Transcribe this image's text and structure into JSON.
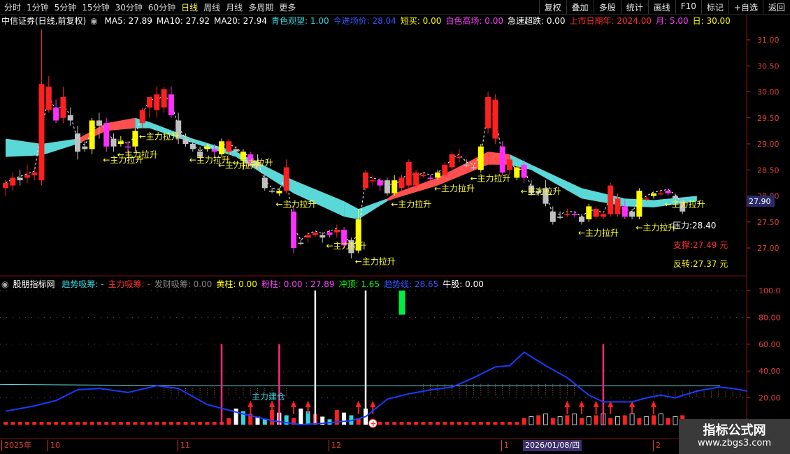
{
  "toolbar": {
    "timeframes": [
      "分时",
      "1分钟",
      "5分钟",
      "15分钟",
      "30分钟",
      "60分钟",
      "日线",
      "周线",
      "月线",
      "多周期",
      "更多"
    ],
    "active_timeframe": "日线",
    "buttons": [
      "复权",
      "叠加",
      "多股",
      "统计",
      "画线",
      "F10",
      "标记",
      "+自选",
      "返回"
    ]
  },
  "main_legend": {
    "title": "中信证券(日线,前复权)",
    "items": [
      {
        "label": "MA5: 27.89",
        "color": "#ffffff"
      },
      {
        "label": "MA10: 27.92",
        "color": "#ffffff"
      },
      {
        "label": "MA20: 27.94",
        "color": "#ffffff"
      },
      {
        "label": "青色观望: 1.00",
        "color": "#33d6e0"
      },
      {
        "label": "今进场价: 28.04",
        "color": "#3355ff"
      },
      {
        "label": "短买: 0.00",
        "color": "#ffff00"
      },
      {
        "label": "白色高场: 0.00",
        "color": "#ff40ff"
      },
      {
        "label": "急速超跌: 0.00",
        "color": "#ffffff"
      },
      {
        "label": "上市日期年: 2024.00",
        "color": "#ff3030"
      },
      {
        "label": "月: 5.00",
        "color": "#ff40ff"
      },
      {
        "label": "日: 30.00",
        "color": "#ffff00"
      }
    ]
  },
  "sub_legend": {
    "title": "股朋指标网",
    "items": [
      {
        "label": "趋势吸筹: -",
        "color": "#33d6e0"
      },
      {
        "label": "主力吸筹: -",
        "color": "#ff3030"
      },
      {
        "label": "发财吸筹: 0.00",
        "color": "#888888"
      },
      {
        "label": "黄柱: 0.00",
        "color": "#ffff00"
      },
      {
        "label": "粉柱: 0.00 : 27.89",
        "color": "#ff40ff"
      },
      {
        "label": "冲顶: 1.65",
        "color": "#00ff00"
      },
      {
        "label": "趋势线: 28.65",
        "color": "#3355ff"
      },
      {
        "label": "牛股: 0.00",
        "color": "#ffffff"
      }
    ]
  },
  "price_axis": {
    "ticks": [
      "31.00",
      "30.50",
      "30.00",
      "29.50",
      "29.00",
      "28.50",
      "28.00",
      "27.50",
      "27.00"
    ],
    "current": "27.90"
  },
  "sub_axis": {
    "ticks": [
      "100.0",
      "80.00",
      "60.00",
      "40.00",
      "20.00"
    ]
  },
  "annotations": {
    "signal_label": "←主力拉升",
    "build_label": "主力建仓",
    "support": "支撑:27.49 元",
    "reversal": "反转:27.37 元",
    "resistance_partial": "压力:28.40"
  },
  "date_axis": {
    "labels": [
      "2025年",
      "10",
      "11",
      "12",
      "1",
      "2"
    ],
    "cursor_date": "2026/01/08/四"
  },
  "watermark": {
    "line1": "指标公式网",
    "line2": "www.zbgs3.com"
  },
  "colors": {
    "up": "#ff2020",
    "down": "#c0c0c0",
    "yellow": "#ffff00",
    "magenta": "#ff30ff",
    "band_cyan": "#5ad8d8",
    "band_red": "#ff5050"
  },
  "chart_data": {
    "type": "candlestick",
    "ylim": [
      26.8,
      31.4
    ],
    "candles": [
      {
        "o": 28.15,
        "h": 28.3,
        "l": 28.0,
        "c": 28.25,
        "k": "up"
      },
      {
        "o": 28.2,
        "h": 28.45,
        "l": 28.1,
        "c": 28.35,
        "k": "up"
      },
      {
        "o": 28.3,
        "h": 28.5,
        "l": 28.2,
        "c": 28.35,
        "k": "down"
      },
      {
        "o": 28.35,
        "h": 28.6,
        "l": 28.25,
        "c": 28.4,
        "k": "up"
      },
      {
        "o": 28.4,
        "h": 28.55,
        "l": 28.3,
        "c": 28.45,
        "k": "up"
      },
      {
        "o": 28.3,
        "h": 31.2,
        "l": 28.2,
        "c": 30.15,
        "k": "up"
      },
      {
        "o": 30.1,
        "h": 30.3,
        "l": 29.6,
        "c": 29.65,
        "k": "up"
      },
      {
        "o": 29.7,
        "h": 29.85,
        "l": 29.4,
        "c": 29.45,
        "k": "mag"
      },
      {
        "o": 29.5,
        "h": 30.1,
        "l": 29.4,
        "c": 29.9,
        "k": "up"
      },
      {
        "o": 29.55,
        "h": 29.7,
        "l": 29.35,
        "c": 29.45,
        "k": "down"
      },
      {
        "o": 29.2,
        "h": 29.35,
        "l": 28.7,
        "c": 28.85,
        "k": "down"
      },
      {
        "o": 28.9,
        "h": 29.05,
        "l": 28.85,
        "c": 28.95,
        "k": "down"
      },
      {
        "o": 28.9,
        "h": 29.5,
        "l": 28.8,
        "c": 29.45,
        "k": "yel"
      },
      {
        "o": 29.45,
        "h": 29.6,
        "l": 29.1,
        "c": 29.35,
        "k": "down"
      },
      {
        "o": 29.4,
        "h": 29.5,
        "l": 28.85,
        "c": 28.95,
        "k": "mag"
      },
      {
        "o": 28.95,
        "h": 29.2,
        "l": 28.85,
        "c": 29.1,
        "k": "down"
      },
      {
        "o": 29.05,
        "h": 29.15,
        "l": 28.95,
        "c": 29.0,
        "k": "yel"
      },
      {
        "o": 28.95,
        "h": 29.05,
        "l": 28.8,
        "c": 28.95,
        "k": "mag"
      },
      {
        "o": 28.95,
        "h": 29.3,
        "l": 28.85,
        "c": 29.25,
        "k": "yel"
      },
      {
        "o": 29.4,
        "h": 29.7,
        "l": 29.3,
        "c": 29.65,
        "k": "up"
      },
      {
        "o": 29.7,
        "h": 29.9,
        "l": 29.5,
        "c": 29.9,
        "k": "up"
      },
      {
        "o": 29.65,
        "h": 30.1,
        "l": 29.5,
        "c": 29.95,
        "k": "up"
      },
      {
        "o": 29.7,
        "h": 30.1,
        "l": 29.6,
        "c": 30.05,
        "k": "up"
      },
      {
        "o": 29.95,
        "h": 30.1,
        "l": 29.5,
        "c": 29.55,
        "k": "mag"
      },
      {
        "o": 29.45,
        "h": 29.6,
        "l": 29.0,
        "c": 29.1,
        "k": "down"
      },
      {
        "o": 29.1,
        "h": 29.2,
        "l": 28.95,
        "c": 29.0,
        "k": "down"
      },
      {
        "o": 29.0,
        "h": 29.1,
        "l": 28.85,
        "c": 28.9,
        "k": "down"
      },
      {
        "o": 28.85,
        "h": 28.95,
        "l": 28.7,
        "c": 28.75,
        "k": "down"
      },
      {
        "o": 28.9,
        "h": 29.0,
        "l": 28.85,
        "c": 28.95,
        "k": "yel"
      },
      {
        "o": 28.9,
        "h": 29.0,
        "l": 28.75,
        "c": 28.85,
        "k": "mag"
      },
      {
        "o": 28.8,
        "h": 29.1,
        "l": 28.75,
        "c": 29.05,
        "k": "yel"
      },
      {
        "o": 28.85,
        "h": 29.1,
        "l": 28.7,
        "c": 29.05,
        "k": "up"
      },
      {
        "o": 28.85,
        "h": 28.95,
        "l": 28.8,
        "c": 28.9,
        "k": "down"
      },
      {
        "o": 28.7,
        "h": 28.9,
        "l": 28.5,
        "c": 28.85,
        "k": "yel"
      },
      {
        "o": 28.8,
        "h": 28.85,
        "l": 28.55,
        "c": 28.6,
        "k": "mag"
      },
      {
        "o": 28.65,
        "h": 28.8,
        "l": 28.5,
        "c": 28.55,
        "k": "down"
      },
      {
        "o": 28.35,
        "h": 28.45,
        "l": 28.1,
        "c": 28.15,
        "k": "down"
      },
      {
        "o": 28.1,
        "h": 28.15,
        "l": 28.05,
        "c": 28.1,
        "k": "down"
      },
      {
        "o": 28.05,
        "h": 28.15,
        "l": 28.0,
        "c": 28.1,
        "k": "yel"
      },
      {
        "o": 28.1,
        "h": 28.7,
        "l": 28.05,
        "c": 28.55,
        "k": "up"
      },
      {
        "o": 27.7,
        "h": 27.8,
        "l": 26.9,
        "c": 27.0,
        "k": "mag"
      },
      {
        "o": 27.1,
        "h": 27.15,
        "l": 27.05,
        "c": 27.1,
        "k": "down"
      },
      {
        "o": 27.2,
        "h": 27.3,
        "l": 27.1,
        "c": 27.25,
        "k": "up"
      },
      {
        "o": 27.25,
        "h": 27.3,
        "l": 27.2,
        "c": 27.3,
        "k": "up"
      },
      {
        "o": 27.2,
        "h": 27.3,
        "l": 27.1,
        "c": 27.25,
        "k": "down"
      },
      {
        "o": 27.25,
        "h": 27.35,
        "l": 27.2,
        "c": 27.3,
        "k": "mag"
      },
      {
        "o": 27.3,
        "h": 27.45,
        "l": 27.2,
        "c": 27.35,
        "k": "up"
      },
      {
        "o": 27.35,
        "h": 27.4,
        "l": 27.0,
        "c": 27.05,
        "k": "mag"
      },
      {
        "o": 27.15,
        "h": 27.2,
        "l": 26.8,
        "c": 26.9,
        "k": "down"
      },
      {
        "o": 26.95,
        "h": 27.75,
        "l": 26.9,
        "c": 27.55,
        "k": "yel"
      },
      {
        "o": 28.15,
        "h": 28.5,
        "l": 28.1,
        "c": 28.45,
        "k": "up"
      },
      {
        "o": 28.3,
        "h": 28.4,
        "l": 28.2,
        "c": 28.3,
        "k": "up"
      },
      {
        "o": 28.2,
        "h": 28.35,
        "l": 28.1,
        "c": 28.3,
        "k": "mag"
      },
      {
        "o": 28.3,
        "h": 28.35,
        "l": 28.0,
        "c": 28.05,
        "k": "down"
      },
      {
        "o": 28.05,
        "h": 28.4,
        "l": 28.0,
        "c": 28.3,
        "k": "yel"
      },
      {
        "o": 28.15,
        "h": 28.4,
        "l": 28.1,
        "c": 28.35,
        "k": "up"
      },
      {
        "o": 28.2,
        "h": 28.7,
        "l": 28.15,
        "c": 28.65,
        "k": "up"
      },
      {
        "o": 28.2,
        "h": 28.5,
        "l": 28.15,
        "c": 28.45,
        "k": "up"
      },
      {
        "o": 28.4,
        "h": 28.45,
        "l": 28.35,
        "c": 28.4,
        "k": "up"
      },
      {
        "o": 28.35,
        "h": 28.4,
        "l": 28.3,
        "c": 28.35,
        "k": "mag"
      },
      {
        "o": 28.35,
        "h": 28.5,
        "l": 28.3,
        "c": 28.45,
        "k": "yel"
      },
      {
        "o": 28.4,
        "h": 28.65,
        "l": 28.35,
        "c": 28.6,
        "k": "up"
      },
      {
        "o": 28.55,
        "h": 28.85,
        "l": 28.5,
        "c": 28.8,
        "k": "up"
      },
      {
        "o": 28.75,
        "h": 28.9,
        "l": 28.65,
        "c": 28.75,
        "k": "up"
      },
      {
        "o": 28.6,
        "h": 28.7,
        "l": 28.55,
        "c": 28.6,
        "k": "down"
      },
      {
        "o": 28.55,
        "h": 28.6,
        "l": 28.5,
        "c": 28.55,
        "k": "down"
      },
      {
        "o": 28.5,
        "h": 29.0,
        "l": 28.45,
        "c": 28.95,
        "k": "yel"
      },
      {
        "o": 29.3,
        "h": 30.0,
        "l": 29.2,
        "c": 29.9,
        "k": "up"
      },
      {
        "o": 29.1,
        "h": 29.95,
        "l": 29.0,
        "c": 29.85,
        "k": "up"
      },
      {
        "o": 28.95,
        "h": 29.05,
        "l": 28.4,
        "c": 28.45,
        "k": "mag"
      },
      {
        "o": 28.5,
        "h": 28.8,
        "l": 28.4,
        "c": 28.7,
        "k": "up"
      },
      {
        "o": 28.35,
        "h": 28.6,
        "l": 28.3,
        "c": 28.55,
        "k": "yel"
      },
      {
        "o": 28.6,
        "h": 28.7,
        "l": 28.25,
        "c": 28.35,
        "k": "mag"
      },
      {
        "o": 28.2,
        "h": 28.3,
        "l": 28.0,
        "c": 28.05,
        "k": "down"
      },
      {
        "o": 28.05,
        "h": 28.15,
        "l": 28.0,
        "c": 28.1,
        "k": "down"
      },
      {
        "o": 28.15,
        "h": 28.3,
        "l": 27.8,
        "c": 27.85,
        "k": "down"
      },
      {
        "o": 27.7,
        "h": 27.8,
        "l": 27.45,
        "c": 27.5,
        "k": "down"
      },
      {
        "o": 27.6,
        "h": 27.7,
        "l": 27.55,
        "c": 27.6,
        "k": "down"
      },
      {
        "o": 27.65,
        "h": 27.75,
        "l": 27.6,
        "c": 27.65,
        "k": "up"
      },
      {
        "o": 27.65,
        "h": 27.7,
        "l": 27.6,
        "c": 27.65,
        "k": "mag"
      },
      {
        "o": 27.5,
        "h": 27.65,
        "l": 27.45,
        "c": 27.6,
        "k": "down"
      },
      {
        "o": 27.55,
        "h": 27.85,
        "l": 27.5,
        "c": 27.8,
        "k": "yel"
      },
      {
        "o": 27.6,
        "h": 27.8,
        "l": 27.55,
        "c": 27.75,
        "k": "up"
      },
      {
        "o": 27.6,
        "h": 27.7,
        "l": 27.55,
        "c": 27.65,
        "k": "up"
      },
      {
        "o": 27.65,
        "h": 28.25,
        "l": 27.6,
        "c": 28.2,
        "k": "up"
      },
      {
        "o": 27.65,
        "h": 28.05,
        "l": 27.6,
        "c": 27.95,
        "k": "up"
      },
      {
        "o": 27.8,
        "h": 27.9,
        "l": 27.55,
        "c": 27.6,
        "k": "mag"
      },
      {
        "o": 27.6,
        "h": 27.75,
        "l": 27.55,
        "c": 27.7,
        "k": "down"
      },
      {
        "o": 27.6,
        "h": 28.15,
        "l": 27.55,
        "c": 28.1,
        "k": "yel"
      },
      {
        "o": 27.95,
        "h": 28.0,
        "l": 27.9,
        "c": 27.95,
        "k": "up"
      },
      {
        "o": 28.0,
        "h": 28.05,
        "l": 27.95,
        "c": 28.05,
        "k": "yel"
      },
      {
        "o": 28.05,
        "h": 28.1,
        "l": 28.0,
        "c": 28.05,
        "k": "up"
      },
      {
        "o": 28.1,
        "h": 28.15,
        "l": 28.0,
        "c": 28.05,
        "k": "mag"
      },
      {
        "o": 28.0,
        "h": 28.05,
        "l": 27.9,
        "c": 27.95,
        "k": "down"
      },
      {
        "o": 27.9,
        "h": 27.95,
        "l": 27.65,
        "c": 27.7,
        "k": "down"
      }
    ],
    "signals": [
      14,
      16,
      19,
      26,
      30,
      32,
      38,
      45,
      49,
      54,
      60,
      65,
      72,
      80,
      88,
      92
    ],
    "band": [
      {
        "i": 0,
        "top": 29.1,
        "bot": 28.75,
        "c": "cyan"
      },
      {
        "i": 5,
        "top": 29.0,
        "bot": 28.78,
        "c": "cyan"
      },
      {
        "i": 10,
        "top": 29.1,
        "bot": 29.0,
        "c": "cyan"
      },
      {
        "i": 14,
        "top": 29.4,
        "bot": 29.25,
        "c": "red"
      },
      {
        "i": 18,
        "top": 29.5,
        "bot": 29.3,
        "c": "red"
      },
      {
        "i": 20,
        "top": 29.42,
        "bot": 29.3,
        "c": "cyan"
      },
      {
        "i": 26,
        "top": 29.1,
        "bot": 29.02,
        "c": "cyan"
      },
      {
        "i": 32,
        "top": 28.85,
        "bot": 28.75,
        "c": "cyan"
      },
      {
        "i": 40,
        "top": 28.3,
        "bot": 28.05,
        "c": "cyan"
      },
      {
        "i": 47,
        "top": 27.9,
        "bot": 27.6,
        "c": "cyan"
      },
      {
        "i": 49,
        "top": 27.75,
        "bot": 27.55,
        "c": "cyan"
      },
      {
        "i": 53,
        "top": 27.95,
        "bot": 27.9,
        "c": "cyan"
      },
      {
        "i": 54,
        "top": 28.05,
        "bot": 27.95,
        "c": "red"
      },
      {
        "i": 60,
        "top": 28.35,
        "bot": 28.2,
        "c": "red"
      },
      {
        "i": 67,
        "top": 28.85,
        "bot": 28.6,
        "c": "red"
      },
      {
        "i": 70,
        "top": 28.8,
        "bot": 28.6,
        "c": "red"
      },
      {
        "i": 73,
        "top": 28.6,
        "bot": 28.5,
        "c": "cyan"
      },
      {
        "i": 80,
        "top": 28.15,
        "bot": 27.95,
        "c": "cyan"
      },
      {
        "i": 86,
        "top": 27.95,
        "bot": 27.8,
        "c": "cyan"
      },
      {
        "i": 90,
        "top": 27.92,
        "bot": 27.78,
        "c": "cyan"
      },
      {
        "i": 96,
        "top": 28.0,
        "bot": 27.9,
        "c": "cyan"
      }
    ],
    "trend": [
      [
        0,
        10
      ],
      [
        4,
        14
      ],
      [
        7,
        18
      ],
      [
        10,
        26
      ],
      [
        13,
        27
      ],
      [
        17,
        24
      ],
      [
        21,
        29
      ],
      [
        24,
        27
      ],
      [
        28,
        15
      ],
      [
        33,
        8
      ],
      [
        37,
        3
      ],
      [
        41,
        0
      ],
      [
        44,
        1
      ],
      [
        48,
        3
      ],
      [
        50,
        6
      ],
      [
        53,
        19
      ],
      [
        56,
        23
      ],
      [
        59,
        26
      ],
      [
        62,
        28
      ],
      [
        65,
        35
      ],
      [
        68,
        43
      ],
      [
        70,
        44
      ],
      [
        72,
        54
      ],
      [
        75,
        44
      ],
      [
        78,
        35
      ],
      [
        81,
        22
      ],
      [
        83,
        17
      ],
      [
        87,
        17
      ],
      [
        89,
        20
      ],
      [
        91,
        22
      ],
      [
        93,
        20
      ],
      [
        96,
        25
      ],
      [
        99,
        28
      ],
      [
        101,
        27
      ],
      [
        103,
        25
      ]
    ],
    "spikes": [
      {
        "i": 30,
        "v": 60,
        "c": "#ff2a7a"
      },
      {
        "i": 38,
        "v": 60,
        "c": "#ff2a7a"
      },
      {
        "i": 43,
        "v": 100,
        "c": "#ffffff"
      },
      {
        "i": 50,
        "v": 100,
        "c": "#ffffff"
      },
      {
        "i": 83,
        "v": 60,
        "c": "#ff2a7a"
      }
    ],
    "green_block": {
      "i": 55,
      "lo": 82,
      "hi": 100
    }
  }
}
